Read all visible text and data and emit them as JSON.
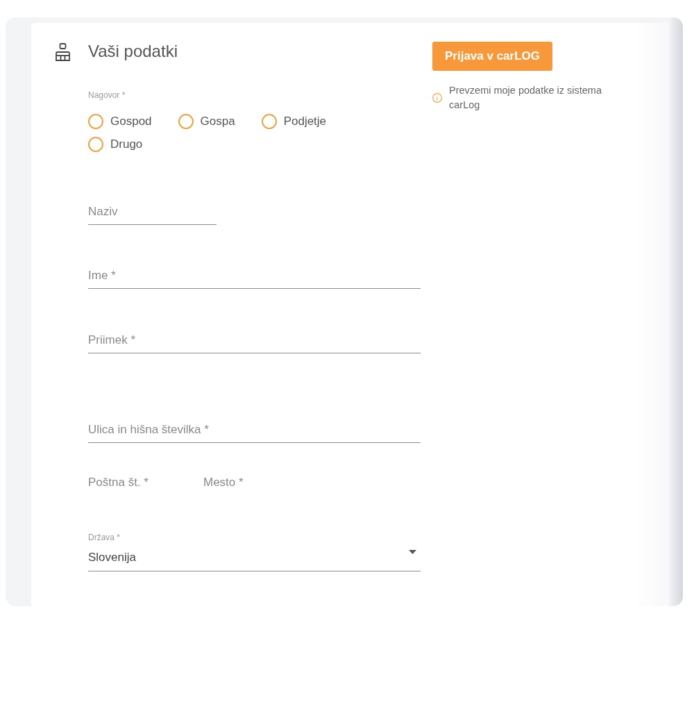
{
  "section": {
    "title": "Vaši podatki"
  },
  "salutation": {
    "label": "Nagovor *",
    "options": [
      {
        "label": "Gospod",
        "selected": false
      },
      {
        "label": "Gospa",
        "selected": false
      },
      {
        "label": "Podjetje",
        "selected": false
      },
      {
        "label": "Drugo",
        "selected": false
      }
    ]
  },
  "fields": [
    {
      "placeholder": "Naziv"
    },
    {
      "placeholder": "Ime *"
    },
    {
      "placeholder": "Priimek *"
    },
    {
      "placeholder": "Ulica in hišna številka *"
    }
  ],
  "postal_row": [
    {
      "placeholder": "Poštna št. *"
    },
    {
      "placeholder": "Mesto *"
    }
  ],
  "country": {
    "label": "Država *",
    "value": "Slovenija"
  },
  "carlog": {
    "button": "Prijava v carLOG",
    "info": "Prevzemi moje podatke iz sistema carLog"
  }
}
